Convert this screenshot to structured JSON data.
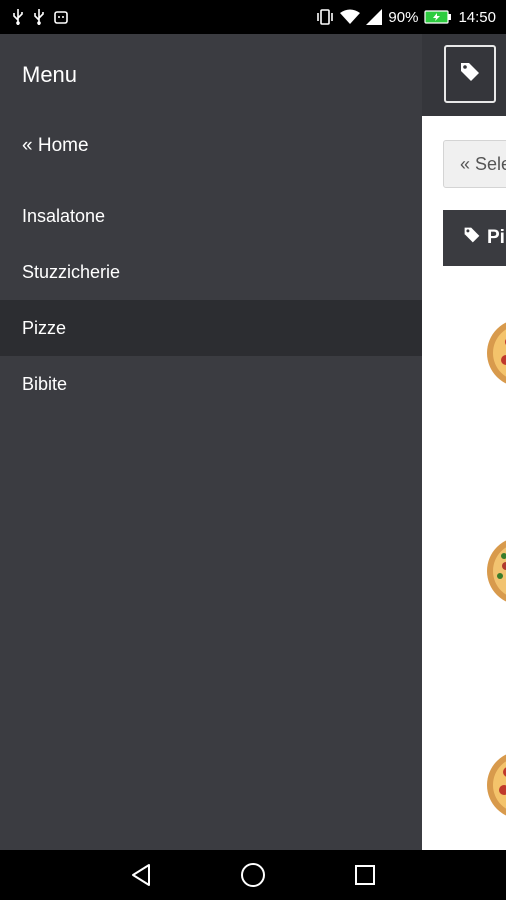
{
  "status_bar": {
    "left_icons": [
      "usb-icon",
      "usb-icon",
      "android-debug-icon"
    ],
    "battery_percent": "90%",
    "time": "14:50",
    "right_icons": [
      "vibrate-icon",
      "wifi-icon",
      "signal-icon",
      "battery-charging-icon"
    ],
    "battery_color": "#2ecc40"
  },
  "drawer": {
    "title": "Menu",
    "home_label": "« Home",
    "items": [
      {
        "label": "Insalatone",
        "active": false
      },
      {
        "label": "Stuzzicherie",
        "active": false
      },
      {
        "label": "Pizze",
        "active": true
      },
      {
        "label": "Bibite",
        "active": false
      }
    ],
    "background_color": "#3b3c41",
    "active_color": "#2c2d31"
  },
  "background_app": {
    "tag_button_icon": "tag-icon",
    "select_button_label": "« Sele",
    "category_header_label": "Pi",
    "category_icon": "tag-icon",
    "product_images": [
      "pizza-image",
      "pizza-image",
      "pizza-image"
    ]
  },
  "nav_bar": {
    "buttons": [
      "back-icon",
      "home-icon",
      "recents-icon"
    ]
  }
}
